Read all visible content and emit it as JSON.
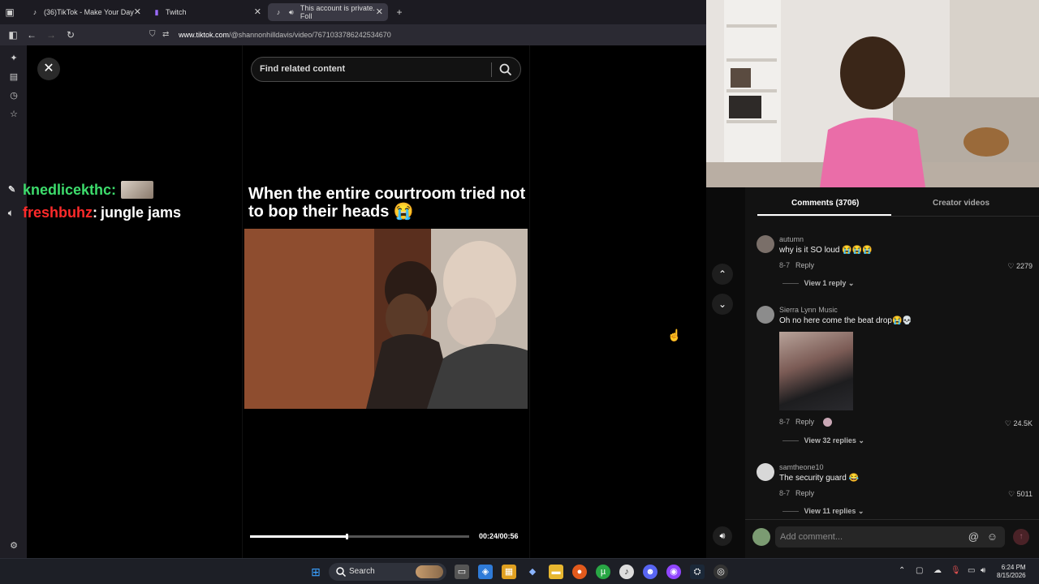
{
  "browser": {
    "tabs": [
      {
        "label": "(36)TikTok - Make Your Day",
        "icon": "tiktok-icon"
      },
      {
        "label": "Twitch",
        "icon": "twitch-icon"
      },
      {
        "label": "This account is private. Foll",
        "icon": "tiktok-icon"
      }
    ],
    "url_domain": "www.tiktok.com",
    "url_path": "/@shannonhilldavis/video/7671033786242534670"
  },
  "player": {
    "search_placeholder": "Find related content",
    "caption": "When the entire courtroom tried not to bop their heads 😭",
    "time": "00:24/00:56",
    "progress_fraction": 0.44
  },
  "chat": [
    {
      "user": "knedlicekthc",
      "message": "",
      "user_color": "#3ddc6c",
      "emote": true
    },
    {
      "user": "freshbuhz",
      "message": "jungle jams",
      "user_color": "#ff2a2a",
      "emote": false
    }
  ],
  "comments_panel": {
    "tab_comments": "Comments (3706)",
    "tab_creator": "Creator videos",
    "comments": [
      {
        "name": "autumn",
        "text": "why is it SO loud 😭😭😭",
        "date": "8-7",
        "reply": "Reply",
        "likes": "2279",
        "view_replies": "View 1 reply"
      },
      {
        "name": "Sierra Lynn Music",
        "text": "Oh no here come the beat drop😭💀",
        "date": "8-7",
        "reply": "Reply",
        "likes": "24.5K",
        "view_replies": "View 32 replies"
      },
      {
        "name": "samtheone10",
        "text": "The security guard 😂",
        "date": "8-7",
        "reply": "Reply",
        "likes": "5011",
        "view_replies": "View 11 replies"
      }
    ],
    "add_comment_placeholder": "Add comment..."
  },
  "taskbar": {
    "search_label": "Search",
    "time": "6:24 PM",
    "date": "8/15/2026"
  }
}
